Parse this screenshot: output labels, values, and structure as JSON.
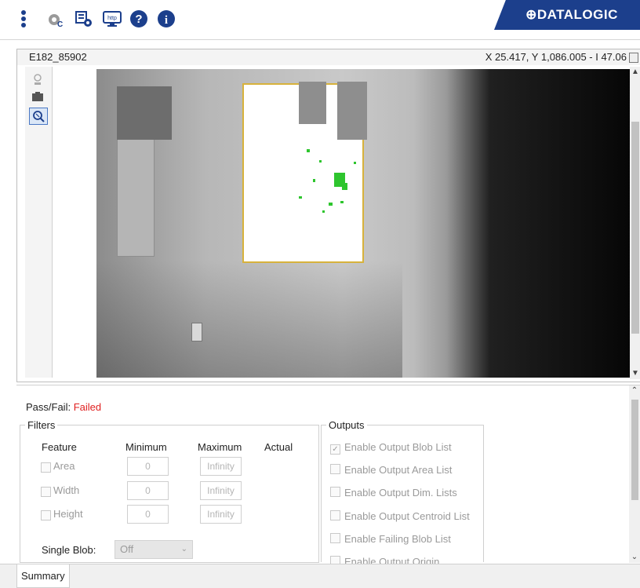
{
  "toolbar": {
    "icons": [
      "vertical-dots-icon",
      "opc-settings-icon",
      "network-settings-icon",
      "http-icon",
      "help-icon",
      "info-icon"
    ],
    "http_label": "http",
    "logo_text": "⊕DATALOGIC",
    "brand_color": "#1c3f8c"
  },
  "image_view": {
    "image_name": "E182_85902",
    "coordinates": "X 25.417,  Y 1,086.005  -  I 47.06"
  },
  "pass_fail": {
    "label": "Pass/Fail:",
    "value": "Failed",
    "value_color": "#e02020"
  },
  "filters": {
    "title": "Filters",
    "headers": {
      "feature": "Feature",
      "minimum": "Minimum",
      "maximum": "Maximum",
      "actual": "Actual"
    },
    "rows": [
      {
        "label": "Area",
        "min": "0",
        "max": "Infinity"
      },
      {
        "label": "Width",
        "min": "0",
        "max": "Infinity"
      },
      {
        "label": "Height",
        "min": "0",
        "max": "Infinity"
      }
    ],
    "single_blob_label": "Single Blob:",
    "single_blob_value": "Off"
  },
  "outputs": {
    "title": "Outputs",
    "items": [
      {
        "label": "Enable Output Blob List",
        "checked": true
      },
      {
        "label": "Enable Output Area List",
        "checked": false
      },
      {
        "label": "Enable Output Dim. Lists",
        "checked": false
      },
      {
        "label": "Enable Output Centroid List",
        "checked": false
      },
      {
        "label": "Enable Failing Blob List",
        "checked": false
      },
      {
        "label": "Enable Output Origin",
        "checked": false
      }
    ]
  },
  "tabs": {
    "summary": "Summary"
  }
}
